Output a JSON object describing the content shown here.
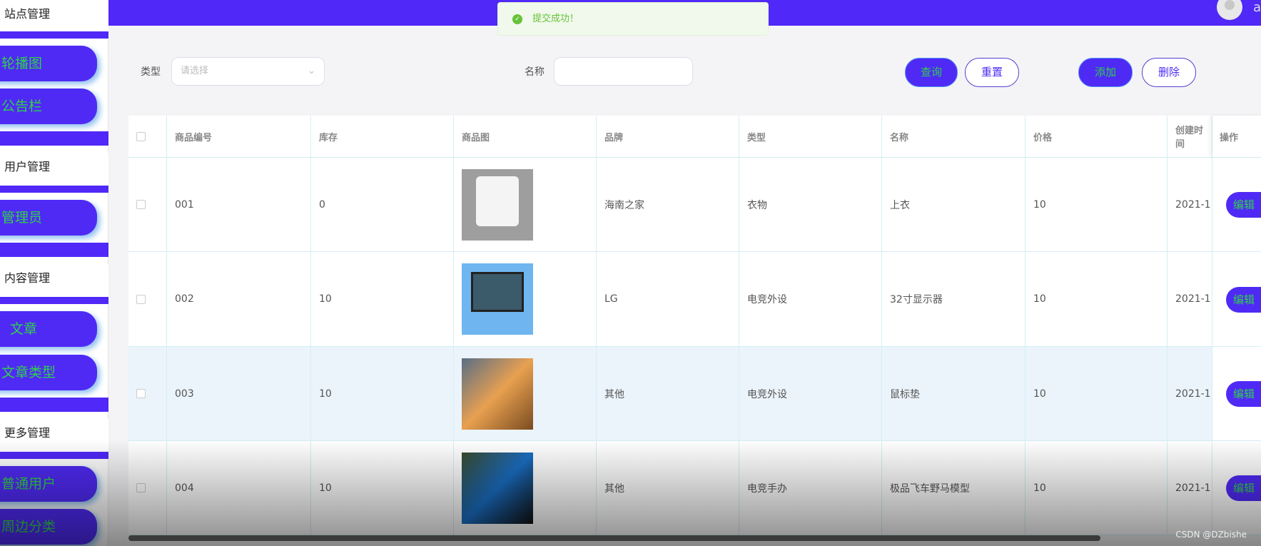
{
  "sidebar": {
    "groups": [
      {
        "title": "站点管理",
        "items": [
          "轮播图",
          "公告栏"
        ]
      },
      {
        "title": "用户管理",
        "items": [
          "管理员"
        ]
      },
      {
        "title": "内容管理",
        "items": [
          "文章",
          "文章类型"
        ]
      },
      {
        "title": "更多管理",
        "items": [
          "普通用户",
          "周边分类"
        ]
      }
    ]
  },
  "header": {
    "username": "a"
  },
  "toast": {
    "message": "提交成功！",
    "icon": "check-circle-icon"
  },
  "search": {
    "type_label": "类型",
    "type_placeholder": "请选择",
    "name_label": "名称",
    "name_value": "",
    "query": "查询",
    "reset": "重置",
    "add": "添加",
    "delete": "删除"
  },
  "table": {
    "columns": [
      "商品编号",
      "库存",
      "商品图",
      "品牌",
      "类型",
      "名称",
      "价格",
      "创建时间",
      "操作"
    ],
    "rows": [
      {
        "id": "001",
        "stock": "0",
        "brand": "海南之家",
        "type": "衣物",
        "name": "上衣",
        "price": "10",
        "created": "2021-1",
        "image": "white-tshirt"
      },
      {
        "id": "002",
        "stock": "10",
        "brand": "LG",
        "type": "电竞外设",
        "name": "32寸显示器",
        "price": "10",
        "created": "2021-1",
        "image": "monitor"
      },
      {
        "id": "003",
        "stock": "10",
        "brand": "其他",
        "type": "电竞外设",
        "name": "鼠标垫",
        "price": "10",
        "created": "2021-1",
        "image": "mousepad"
      },
      {
        "id": "004",
        "stock": "10",
        "brand": "其他",
        "type": "电竞手办",
        "name": "极品飞车野马模型",
        "price": "10",
        "created": "2021-1",
        "image": "car-model"
      }
    ],
    "edit_label": "编辑"
  },
  "watermark": "CSDN @DZbishe"
}
